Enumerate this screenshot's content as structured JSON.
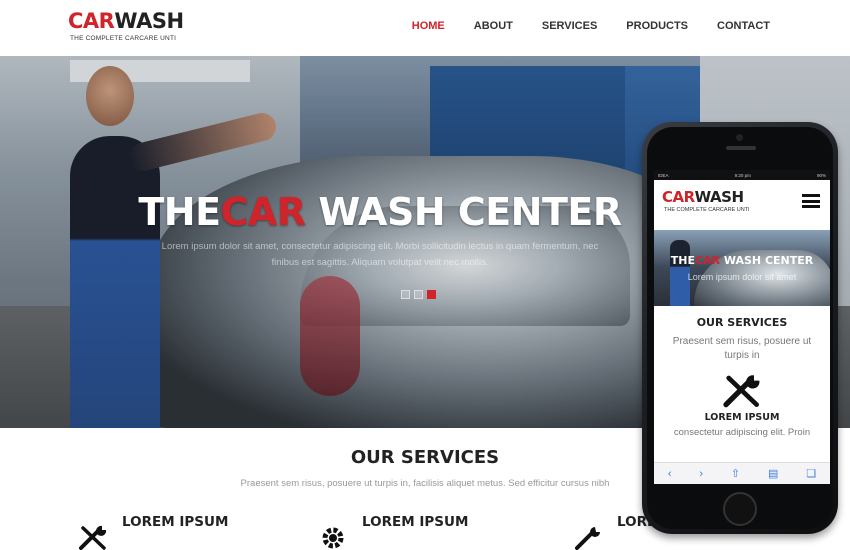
{
  "brand": {
    "part1": "CAR",
    "part2": "WASH",
    "tagline": "THE COMPLETE CARCARE UNTI",
    "accent": "#d0232a"
  },
  "nav": [
    {
      "label": "HOME",
      "active": true
    },
    {
      "label": "ABOUT"
    },
    {
      "label": "SERVICES"
    },
    {
      "label": "PRODUCTS"
    },
    {
      "label": "CONTACT"
    }
  ],
  "hero": {
    "title_pre": "THE",
    "title_accent": "CAR",
    "title_post": " WASH CENTER",
    "subtitle": "Lorem ipsum dolor sit amet, consectetur adipiscing elit. Morbi sollicitudin lectus in quam fermentum, nec finibus est sagittis. Aliquam volutpat velit nec mollis.",
    "slides": 3,
    "active_slide": 3
  },
  "services": {
    "title": "OUR SERVICES",
    "subtitle": "Praesent sem risus, posuere ut turpis in, facilisis aliquet metus. Sed efficitur cursus nibh",
    "items": [
      {
        "label": "LOREM IPSUM",
        "icon": "tools-icon"
      },
      {
        "label": "LOREM IPSUM",
        "icon": "gear-icon"
      },
      {
        "label": "LOREM",
        "icon": "wrench-icon"
      }
    ]
  },
  "phone": {
    "status": {
      "carrier": "IDEA",
      "time": "9:20 pm",
      "battery": "90%"
    },
    "hero_title_pre": "THE",
    "hero_title_accent": "CAR",
    "hero_title_post": " WASH CENTER",
    "hero_sub": "Lorem ipsum dolor sit amet",
    "services_title": "OUR SERVICES",
    "services_sub": "Praesent sem risus, posuere ut turpis in",
    "item_label": "LOREM IPSUM",
    "item_text": "consectetur adipiscing elit. Proin"
  }
}
